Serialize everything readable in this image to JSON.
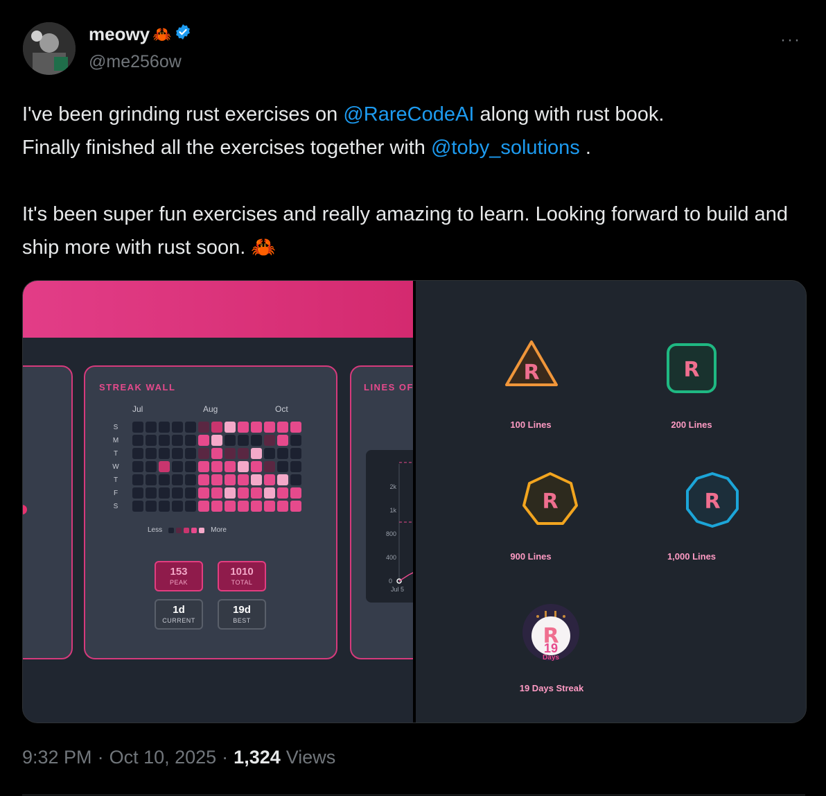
{
  "author": {
    "name": "meowy",
    "handle": "@me256ow",
    "emoji": "🦀"
  },
  "menu_label": "···",
  "tweet": {
    "line1_a": "I've been grinding rust exercises on ",
    "mention1": "@RareCodeAI",
    "line1_b": " along with rust book.",
    "line2_a": "Finally finished all the exercises together with ",
    "mention2": "@toby_solutions",
    "line2_b": " .",
    "para2_a": "It's been super fun exercises and really amazing to learn. Looking forward to build and ship more with rust soon. ",
    "para2_emoji": "🦀"
  },
  "media": {
    "streak_title": "STREAK WALL",
    "lines_title": "LINES OF",
    "months": [
      "Jul",
      "Aug",
      "Oct"
    ],
    "days": [
      "S",
      "M",
      "T",
      "W",
      "T",
      "F",
      "S"
    ],
    "legend_less": "Less",
    "legend_more": "More",
    "stats": [
      {
        "value": "153",
        "label": "PEAK"
      },
      {
        "value": "1010",
        "label": "TOTAL"
      },
      {
        "value": "1d",
        "label": "CURRENT"
      },
      {
        "value": "19d",
        "label": "BEST"
      }
    ],
    "chart_ticks": [
      "2k",
      "1k",
      "800",
      "400",
      "0"
    ],
    "chart_date": "Jul 5",
    "heat": [
      [
        0,
        0,
        0,
        0,
        0,
        1,
        2,
        4,
        3,
        3,
        3,
        3,
        3
      ],
      [
        0,
        0,
        0,
        0,
        0,
        3,
        4,
        0,
        0,
        0,
        1,
        3,
        0
      ],
      [
        0,
        0,
        0,
        0,
        0,
        1,
        3,
        1,
        1,
        4,
        0,
        0,
        0
      ],
      [
        0,
        0,
        2,
        0,
        0,
        3,
        3,
        3,
        4,
        3,
        1,
        0,
        0
      ],
      [
        0,
        0,
        0,
        0,
        0,
        3,
        3,
        3,
        3,
        4,
        3,
        4,
        0
      ],
      [
        0,
        0,
        0,
        0,
        0,
        3,
        3,
        4,
        3,
        3,
        4,
        3,
        3
      ],
      [
        0,
        0,
        0,
        0,
        0,
        3,
        3,
        3,
        3,
        3,
        3,
        3,
        3
      ]
    ],
    "heat_colors": [
      "#1c2130",
      "#5a2742",
      "#c9356e",
      "#e64a8c",
      "#f4a9c9"
    ],
    "badges": [
      {
        "label": "100 Lines",
        "icon": "triangle-badge-icon",
        "color": "#f0963a"
      },
      {
        "label": "200 Lines",
        "icon": "square-badge-icon",
        "color": "#1fb882"
      },
      {
        "label": "900 Lines",
        "icon": "heptagon-badge-icon",
        "color": "#f2a51f"
      },
      {
        "label": "1,000 Lines",
        "icon": "decagon-badge-icon",
        "color": "#1ca5d8"
      },
      {
        "label": "19 Days Streak",
        "icon": "streak-cake-icon",
        "color": "#e64a8c"
      }
    ],
    "streak_badge_number": "19",
    "streak_badge_unit": "Days"
  },
  "footer": {
    "time": "9:32 PM",
    "sep1": "·",
    "date": "Oct 10, 2025",
    "sep2": "·",
    "views_count": "1,324",
    "views_label": "Views"
  },
  "colors": {
    "mention": "#1d9bf0",
    "verified": "#1d9bf0",
    "accent_pink": "#e64a8c"
  }
}
